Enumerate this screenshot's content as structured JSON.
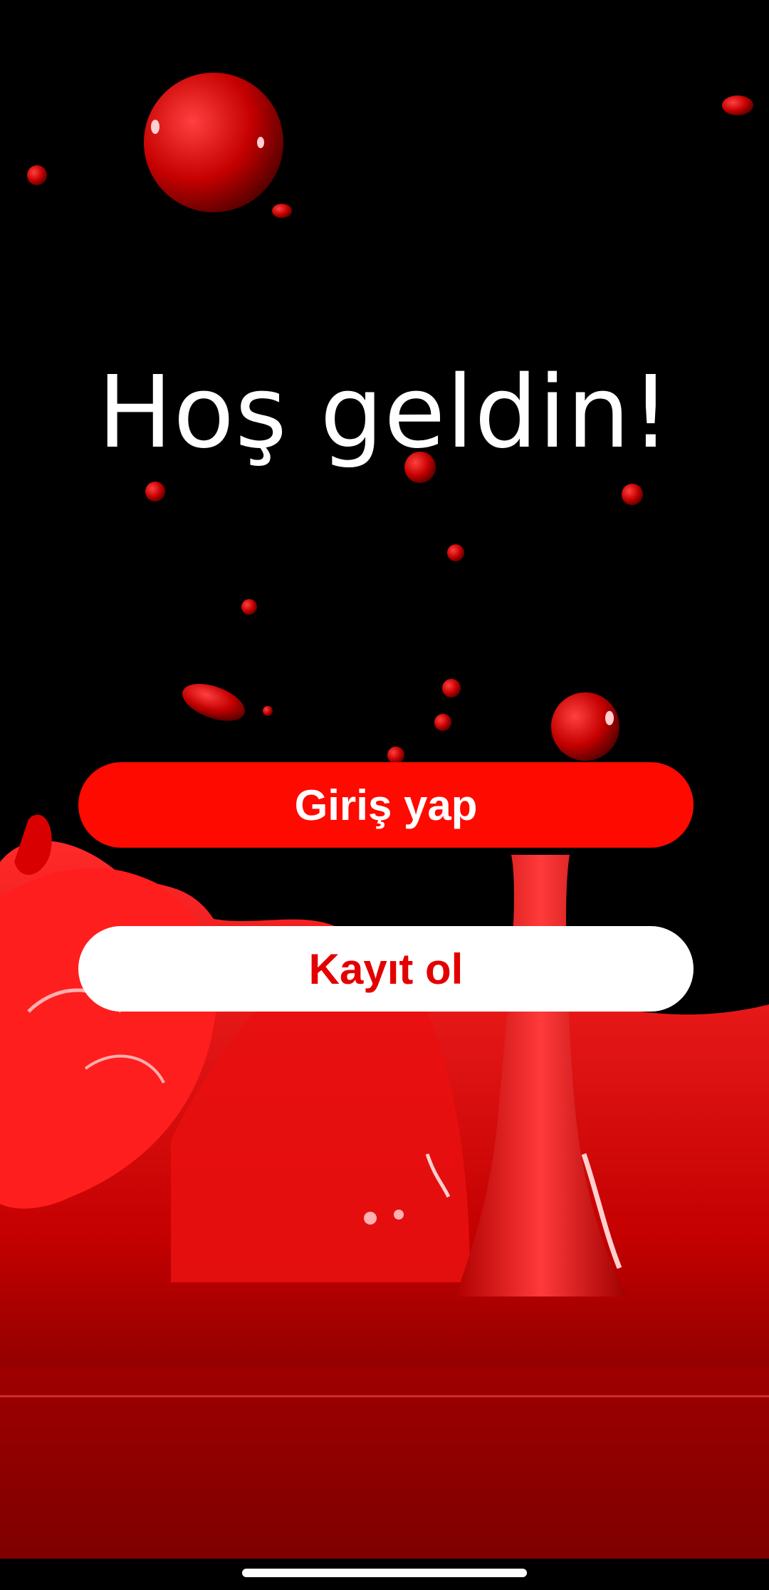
{
  "welcome": {
    "title": "Hoş geldin!"
  },
  "actions": {
    "login_label": "Giriş yap",
    "register_label": "Kayıt ol"
  },
  "colors": {
    "background": "#000000",
    "primary_red": "#ff0a00",
    "register_text": "#e30000",
    "white": "#ffffff"
  },
  "background_art": {
    "icon": "red-liquid-splash-image"
  }
}
